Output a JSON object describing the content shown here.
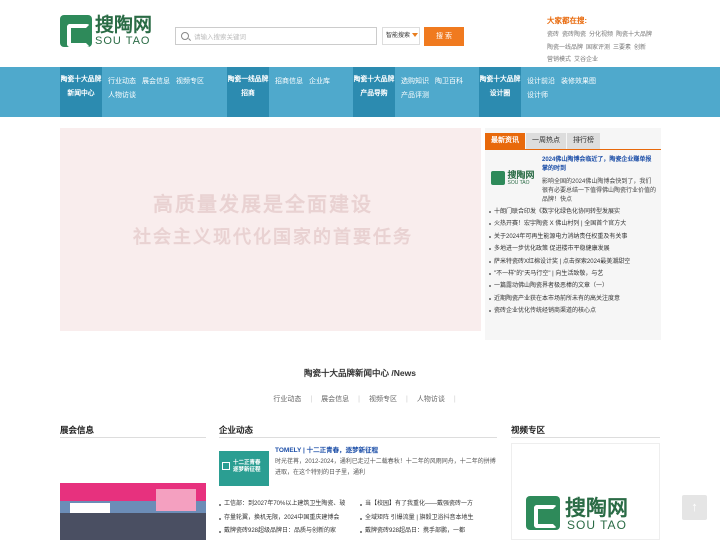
{
  "header": {
    "logo_text": "搜陶网",
    "logo_sub": "SOU TAO",
    "search_placeholder": "请输入搜索关键词",
    "assoc_label": "智能搜索",
    "search_button": "搜 索",
    "hot_title": "大家都在搜:",
    "hot_keywords": [
      "瓷砖",
      "瓷砖陶瓷",
      "分化视频",
      "陶瓷十大品牌",
      "陶瓷一线品牌",
      "国家评测",
      "三要素",
      "创新",
      "营销模式",
      "艾谷企业"
    ]
  },
  "nav": [
    {
      "title": "陶瓷十大品牌新闻中心",
      "items": [
        "行业动态",
        "展会信息",
        "视频专区",
        "人物访谈"
      ]
    },
    {
      "title": "陶瓷一线品牌招商",
      "items": [
        "招商信息",
        "企业库"
      ]
    },
    {
      "title": "陶瓷十大品牌产品导购",
      "items": [
        "选购知识",
        "陶卫百科",
        "产品评测"
      ]
    },
    {
      "title": "陶瓷十大品牌设计圈",
      "items": [
        "设计前沿",
        "装修效果图",
        "设计师"
      ]
    }
  ],
  "banner": {
    "line1": "高质量发展是全面建设",
    "line2": "社会主义现代化国家的首要任务"
  },
  "news": {
    "tabs": [
      "最新资讯",
      "一周热点",
      "排行榜"
    ],
    "featured_title": "2024佛山陶博会临近了，陶瓷企业赚单报掌的时到",
    "featured_logo": "搜陶网",
    "featured_logo_sub": "SOU TAO",
    "featured_desc": "影响全国的2024佛山陶博会快到了，我们很有必要总结一下值得佛山陶瓷行业价值的品牌！快点",
    "items": [
      "十朗门联合印发《数字化绿色化协同转型发展实",
      "火热开赛！宏宇陶瓷 X 佛山村列 | 全国首个官方大",
      "关于2024年可再生能源电力消纳责任权重及有关事",
      "多地进一步优化政策 促进楼市平稳健康发展",
      "萨米特瓷砖X红棉设计奖 | 点击探索2024最美潮甜空",
      "\"不一样\"的\"天马行空\" | 向生活致敬，与艺",
      "一篇露动佛山陶瓷界者极恶棒的文章（一）",
      "近期陶瓷产业获在本市场前所未有的高关注度意",
      "瓷砖企业优化传统经销商渠道的核心点"
    ]
  },
  "section": {
    "title": "陶瓷十大品牌新闻中心 /News",
    "subnav": [
      "行业动态",
      "展会信息",
      "视频专区",
      "人物访谈"
    ]
  },
  "columns": {
    "exhibit_title": "展会信息",
    "enterprise_title": "企业动态",
    "video_title": "视频专区"
  },
  "enterprise": {
    "img_text": "十二正青春 逐梦新征程",
    "title": "TOMELY | 十二正青春，逐梦新征程",
    "desc": "时光荏苒，2012-2024，通利已走过十二载春秋！十二年的风雨同舟，十二年的拼搏进取，在这个特别的日子里，通利",
    "left_items": [
      "工信部：到2027年70%以上建筑卫生陶瓷、玻",
      "存量轮翼，换机无限，2024中国重庆建博会",
      "戴牌瓷砖928超级品牌日：品质与创新的家"
    ],
    "right_items": [
      "当【校园】有了我重化——戴强瓷砖一方",
      "全域矩阵 引爆流量 | 旗毅卫浴抖音本地生",
      "戴牌瓷砖928超品日：携手部鹏，一都"
    ]
  },
  "video": {
    "logo_text": "搜陶网",
    "logo_sub": "SOU TAO"
  },
  "to_top": "↑"
}
